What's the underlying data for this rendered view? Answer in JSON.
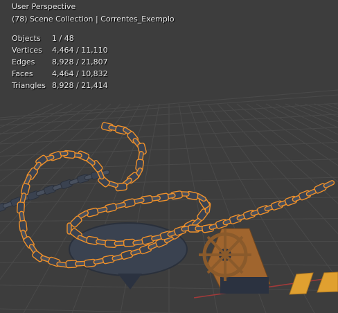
{
  "viewport": {
    "perspective": "User Perspective",
    "collection": "(78) Scene Collection | Correntes_Exemplo"
  },
  "stats": [
    {
      "label": "Objects",
      "value": "1 / 48"
    },
    {
      "label": "Vertices",
      "value": "4,464 / 11,110"
    },
    {
      "label": "Edges",
      "value": "8,928 / 21,807"
    },
    {
      "label": "Faces",
      "value": "4,464 / 10,832"
    },
    {
      "label": "Triangles",
      "value": "8,928 / 21,414"
    }
  ],
  "colors": {
    "background": "#3d3d3d",
    "grid": "#4a4a4a",
    "selection_outline": "#f0912a",
    "chain_metal": "#3a4250",
    "wood": "#a0652e",
    "axis_x": "#a33a3a"
  }
}
